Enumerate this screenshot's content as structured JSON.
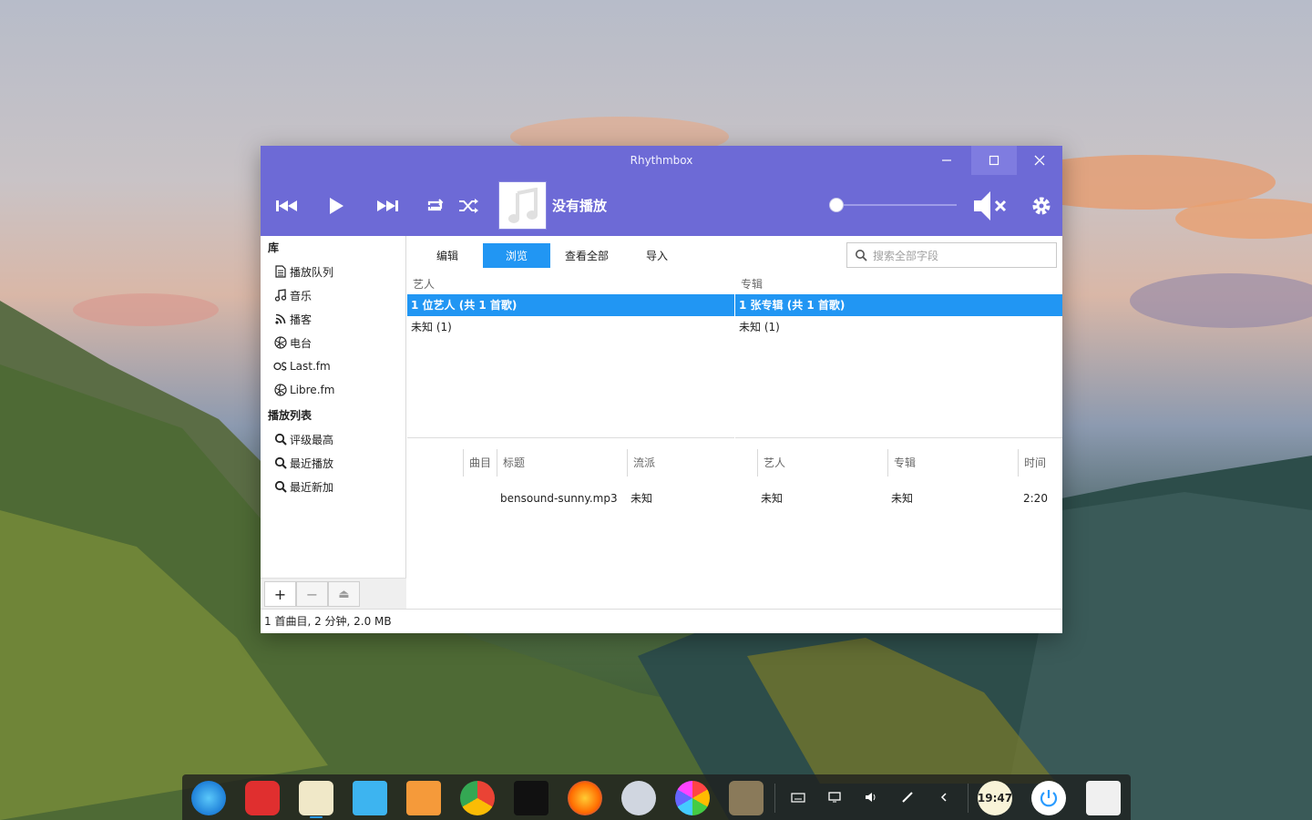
{
  "window": {
    "title": "Rhythmbox"
  },
  "player": {
    "now_playing": "没有播放",
    "volume": 0,
    "muted": true
  },
  "sidebar": {
    "library_header": "库",
    "library_items": [
      {
        "label": "播放队列",
        "icon": "queue-icon"
      },
      {
        "label": "音乐",
        "icon": "music-note-icon"
      },
      {
        "label": "播客",
        "icon": "rss-icon"
      },
      {
        "label": "电台",
        "icon": "radio-icon"
      },
      {
        "label": "Last.fm",
        "icon": "lastfm-icon"
      },
      {
        "label": "Libre.fm",
        "icon": "librefm-icon"
      }
    ],
    "playlist_header": "播放列表",
    "playlist_items": [
      {
        "label": "评级最高",
        "icon": "search-icon"
      },
      {
        "label": "最近播放",
        "icon": "search-icon"
      },
      {
        "label": "最近新加",
        "icon": "search-icon"
      }
    ],
    "buttons": {
      "add": "+",
      "remove": "−",
      "eject": "⏏"
    }
  },
  "tabs": [
    "编辑",
    "浏览",
    "查看全部",
    "导入"
  ],
  "active_tab": "浏览",
  "search": {
    "placeholder": "搜索全部字段"
  },
  "browser": {
    "artist_header": "艺人",
    "artist_rows": [
      "1 位艺人 (共 1 首歌)",
      "未知 (1)"
    ],
    "album_header": "专辑",
    "album_rows": [
      "1 张专辑 (共 1 首歌)",
      "未知 (1)"
    ]
  },
  "track_list": {
    "columns": [
      "曲目",
      "标题",
      "流派",
      "艺人",
      "专辑",
      "时间"
    ],
    "rows": [
      {
        "track": "",
        "title": "bensound-sunny.mp3",
        "genre": "未知",
        "artist": "未知",
        "album": "未知",
        "time": "2:20"
      }
    ]
  },
  "status": "1 首曲目, 2 分钟, 2.0 MB",
  "dock": {
    "clock": "19:47",
    "apps": [
      "deepin-launcher-icon",
      "netease-music-icon",
      "deepin-music-icon",
      "file-manager-icon",
      "app-store-icon",
      "chrome-icon",
      "inkscape-icon",
      "firefox-icon",
      "settings-icon",
      "color-picker-icon",
      "gimp-icon"
    ],
    "tray": [
      "keyboard-icon",
      "desktop-icon",
      "volume-icon",
      "pen-icon",
      "chevron-left-icon"
    ]
  },
  "colors": {
    "accent": "#6d6ad6",
    "selection": "#2196f3"
  }
}
